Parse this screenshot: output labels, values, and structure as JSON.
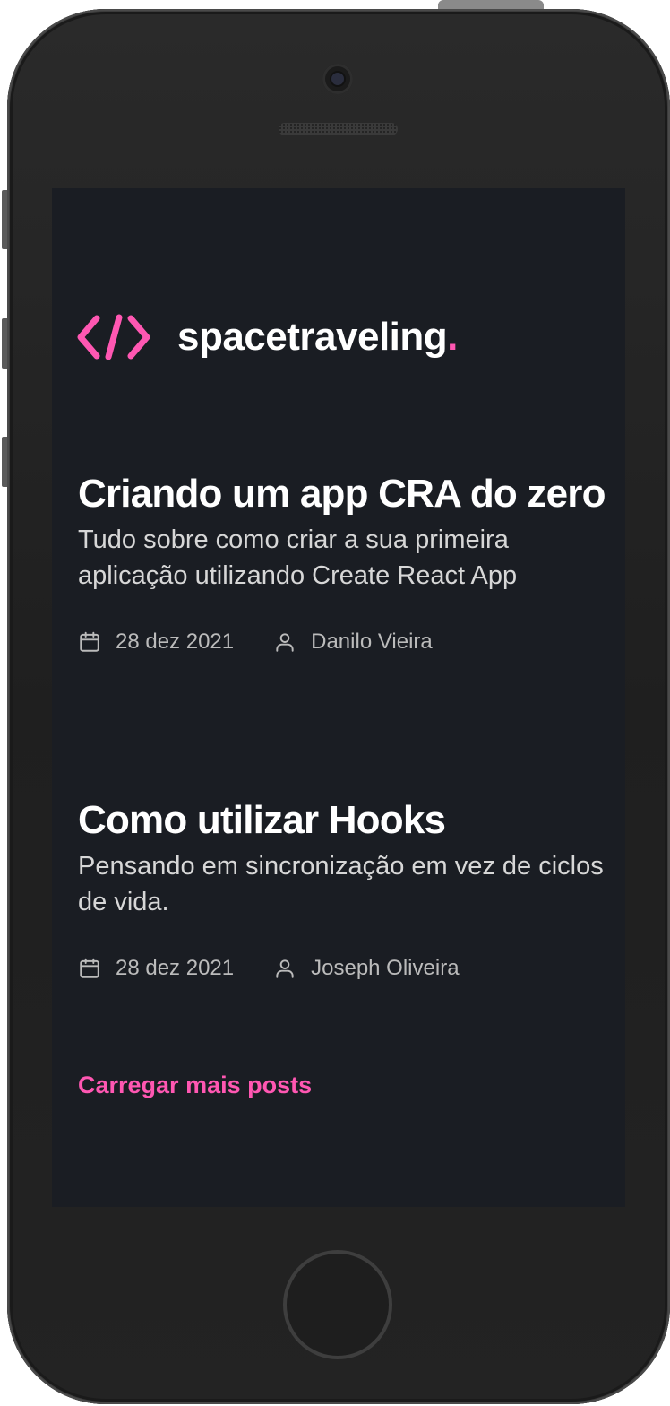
{
  "app": {
    "brand": "spacetraveling",
    "brand_dot": ".",
    "accent_color": "#ff57b2",
    "background_color": "#1a1d23"
  },
  "posts": [
    {
      "title": "Criando um app CRA do zero",
      "subtitle": "Tudo sobre como criar a sua primeira aplicação utilizando Create React App",
      "date": "28 dez 2021",
      "author": "Danilo Vieira",
      "date_icon": "calendar-icon",
      "author_icon": "user-icon"
    },
    {
      "title": "Como utilizar Hooks",
      "subtitle": "Pensando em sincronização em vez de ciclos de vida.",
      "date": "28 dez 2021",
      "author": "Joseph Oliveira",
      "date_icon": "calendar-icon",
      "author_icon": "user-icon"
    }
  ],
  "load_more_label": "Carregar mais posts"
}
